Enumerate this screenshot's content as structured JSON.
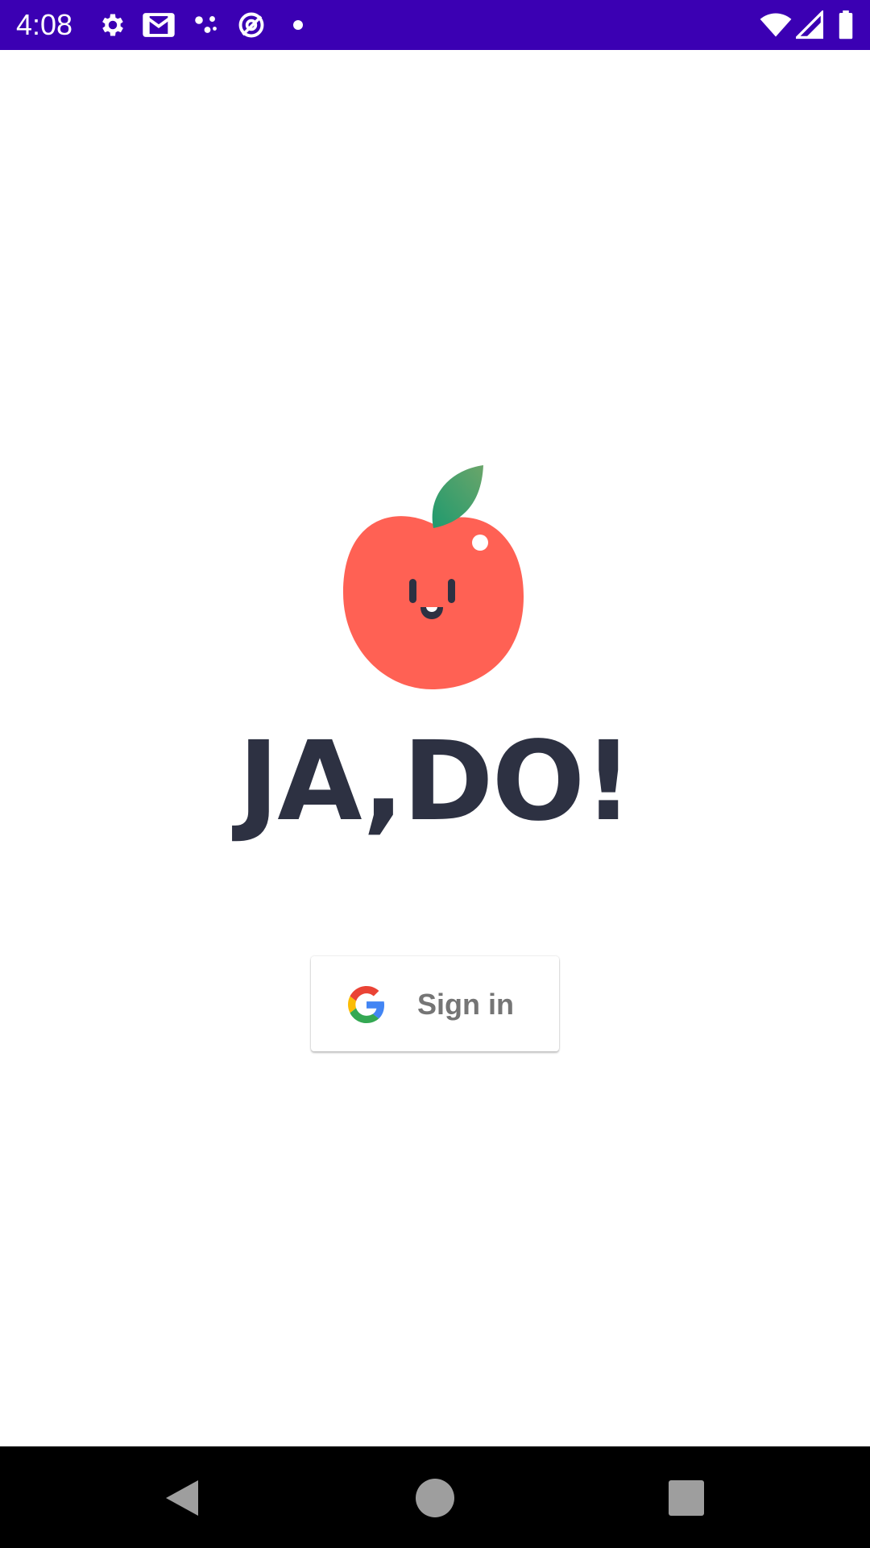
{
  "status_bar": {
    "time": "4:08",
    "background": "#3b00b3",
    "left_icons": [
      "settings-icon",
      "gmail-icon",
      "assistant-dots-icon",
      "no-location-icon",
      "dot-icon"
    ],
    "right_icons": [
      "wifi-icon",
      "signal-icon",
      "battery-icon"
    ]
  },
  "app": {
    "name": "JA,DO!",
    "logo_icon": "apple-mascot-icon",
    "wordmark_color": "#2d3142",
    "apple_color": "#ff6154",
    "leaf_color": "#2e9a6a"
  },
  "signin": {
    "label": "Sign in",
    "icon": "google-icon"
  },
  "nav_bar": {
    "buttons": [
      "back",
      "home",
      "recents"
    ]
  }
}
